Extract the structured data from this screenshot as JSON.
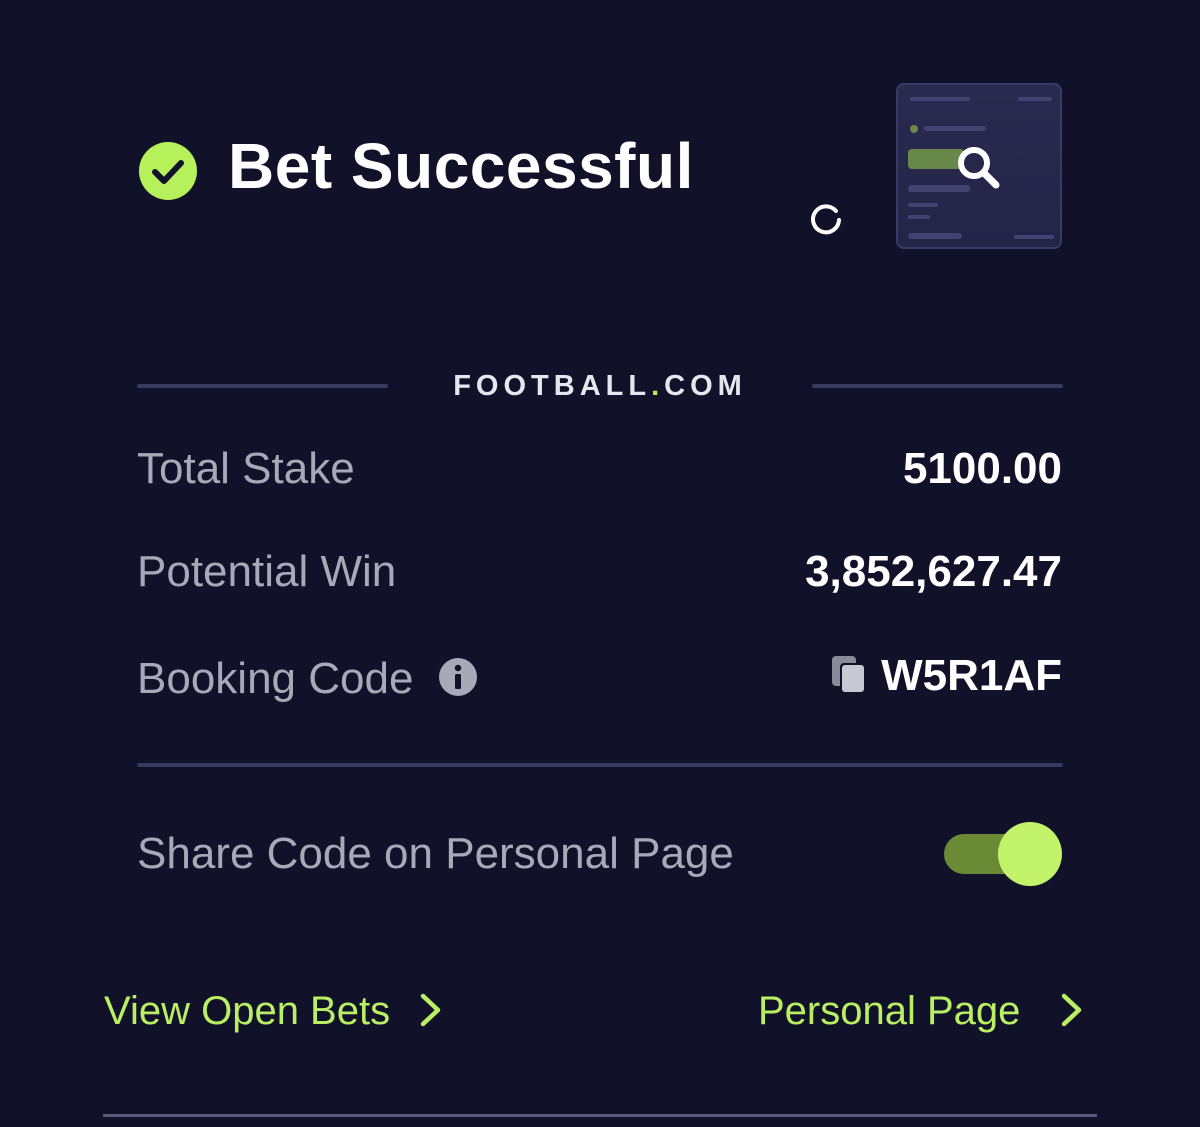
{
  "header": {
    "title": "Bet Successful",
    "status_icon": "check-circle-icon",
    "loading_icon": "spinner-icon",
    "preview_icon": "magnifier-icon"
  },
  "brand": {
    "name_part1": "FOOTBALL",
    "name_dot": ".",
    "name_part2": "COM"
  },
  "summary": {
    "total_stake_label": "Total Stake",
    "total_stake_value": "5100.00",
    "potential_win_label": "Potential Win",
    "potential_win_value": "3,852,627.47",
    "booking_code_label": "Booking Code",
    "booking_code_value": "W5R1AF"
  },
  "share": {
    "label": "Share Code on Personal Page",
    "enabled": true
  },
  "links": {
    "view_open_bets": "View Open Bets",
    "personal_page": "Personal Page"
  },
  "colors": {
    "background": "#12112a",
    "accent_green": "#b9ef62",
    "label_gray": "#a8a8b8",
    "divider": "#3a3960"
  }
}
